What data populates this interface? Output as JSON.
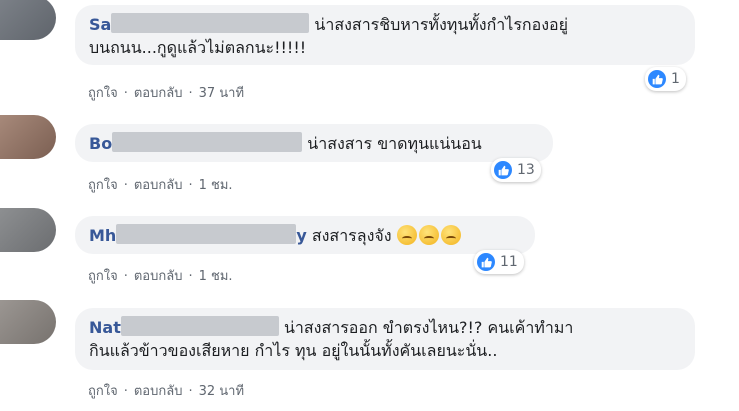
{
  "comments": [
    {
      "name_visible": "Sa",
      "text_line1": "น่าสงสารชิบหารทั้งทุนทั้งกำไรกองอยู่",
      "text_line2": "บนถนน...กูดูแล้วไม่ตลกนะ!!!!!",
      "likes": "1",
      "like_label": "ถูกใจ",
      "reply_label": "ตอบกลับ",
      "time": "37 นาที"
    },
    {
      "name_visible": "Bo",
      "text_line1": "น่าสงสาร ขาดทุนแน่นอน",
      "likes": "13",
      "like_label": "ถูกใจ",
      "reply_label": "ตอบกลับ",
      "time": "1 ชม."
    },
    {
      "name_visible": "Mh",
      "name_tail": "y",
      "text_line1": "สงสารลุงจัง",
      "emoji_count": 3,
      "likes": "11",
      "like_label": "ถูกใจ",
      "reply_label": "ตอบกลับ",
      "time": "1 ชม."
    },
    {
      "name_visible": "Nat",
      "text_line1": "น่าสงสารออก ขำตรงไหน?!? คนเค้าทำมา",
      "text_line2": "กินแล้วข้าวของเสียหาย กำไร ทุน อยู่ในนั้นทั้งคันเลยนะนั่น..",
      "like_label": "ถูกใจ",
      "reply_label": "ตอบกลับ",
      "time": "32 นาที"
    }
  ],
  "colors": {
    "name": "#385898",
    "bubble": "#f2f3f5",
    "like": "#2d88ff",
    "meta": "#606770"
  },
  "separator": "·"
}
